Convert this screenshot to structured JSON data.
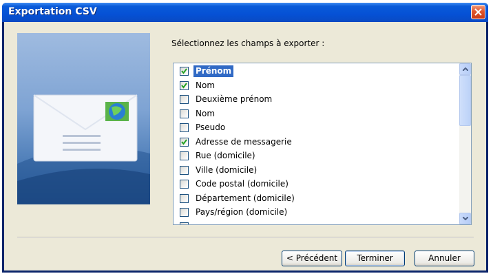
{
  "window": {
    "title": "Exportation CSV"
  },
  "prompt": {
    "text": "Sélectionnez les champs à exporter :"
  },
  "fields": [
    {
      "label": "Prénom",
      "checked": true,
      "selected": true
    },
    {
      "label": "Nom",
      "checked": true,
      "selected": false
    },
    {
      "label": "Deuxième prénom",
      "checked": false,
      "selected": false
    },
    {
      "label": "Nom",
      "checked": false,
      "selected": false
    },
    {
      "label": "Pseudo",
      "checked": false,
      "selected": false
    },
    {
      "label": "Adresse de messagerie",
      "checked": true,
      "selected": false
    },
    {
      "label": "Rue (domicile)",
      "checked": false,
      "selected": false
    },
    {
      "label": "Ville (domicile)",
      "checked": false,
      "selected": false
    },
    {
      "label": "Code postal (domicile)",
      "checked": false,
      "selected": false
    },
    {
      "label": "Département (domicile)",
      "checked": false,
      "selected": false
    },
    {
      "label": "Pays/région (domicile)",
      "checked": false,
      "selected": false
    }
  ],
  "buttons": {
    "previous": "< Précédent",
    "finish": "Terminer",
    "cancel": "Annuler"
  },
  "colors": {
    "titlebar": "#0551d5",
    "selection": "#316ac5",
    "dialog_bg": "#ece9d8"
  },
  "icons": {
    "close": "close-icon",
    "banner": "envelope-globe-icon"
  }
}
